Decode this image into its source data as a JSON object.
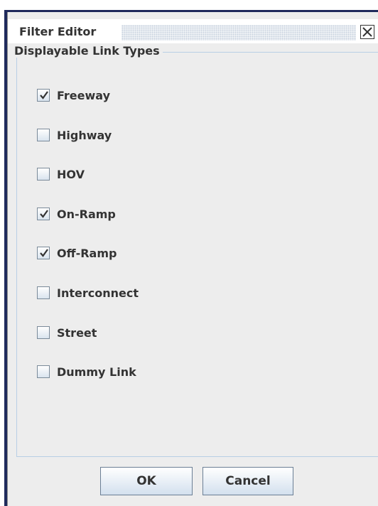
{
  "window": {
    "title": "Filter Editor",
    "close_icon": "close-icon"
  },
  "group": {
    "title": "Displayable Link Types"
  },
  "options": [
    {
      "label": "Freeway",
      "checked": true
    },
    {
      "label": "Highway",
      "checked": false
    },
    {
      "label": "HOV",
      "checked": false
    },
    {
      "label": "On-Ramp",
      "checked": true
    },
    {
      "label": "Off-Ramp",
      "checked": true
    },
    {
      "label": "Interconnect",
      "checked": false
    },
    {
      "label": "Street",
      "checked": false
    },
    {
      "label": "Dummy Link",
      "checked": false
    }
  ],
  "buttons": {
    "ok": "OK",
    "cancel": "Cancel"
  },
  "colors": {
    "frame": "#1f2a5c",
    "group_border": "#b8cfe5",
    "dialog_bg": "#ededed"
  }
}
